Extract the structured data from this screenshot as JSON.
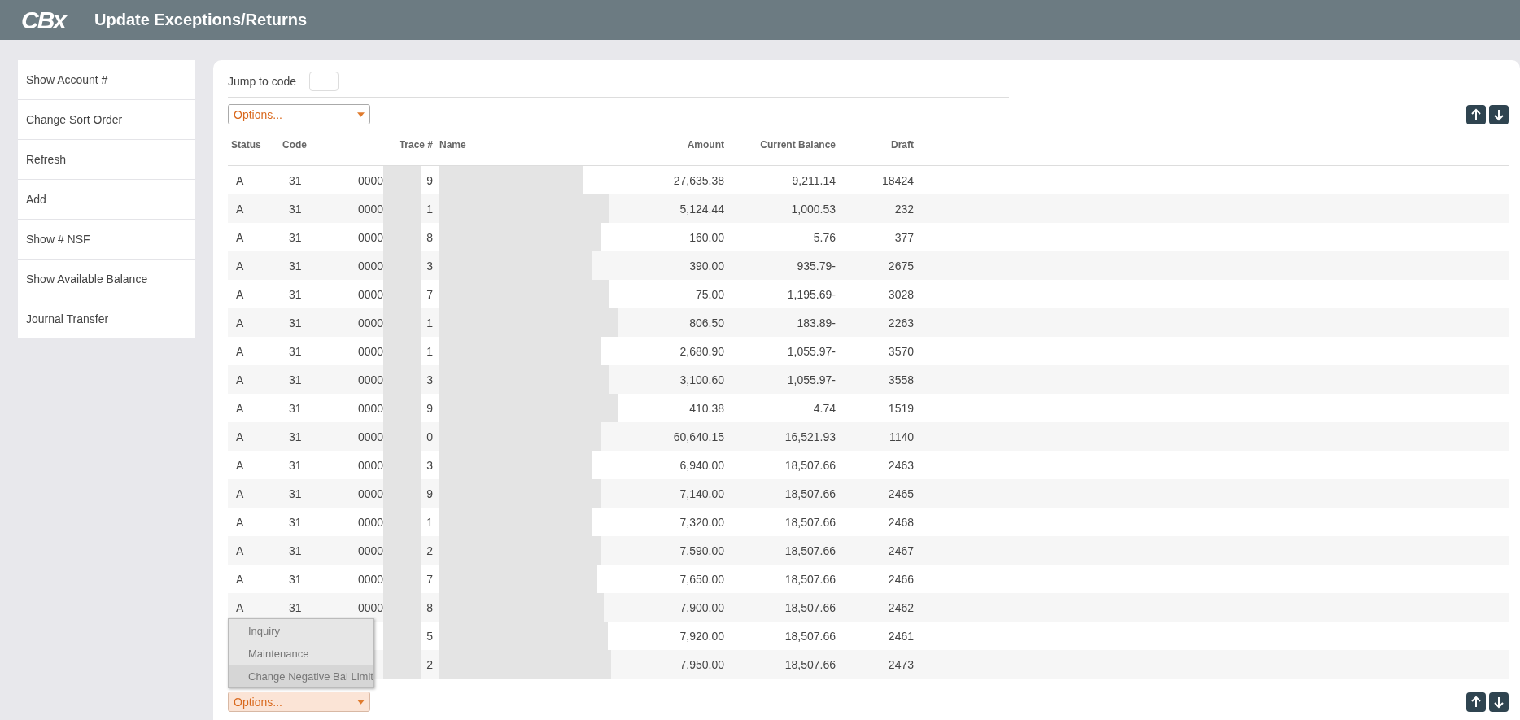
{
  "header": {
    "logo": "CBx",
    "title": "Update Exceptions/Returns"
  },
  "sidebar": {
    "items": [
      {
        "label": "Show Account #"
      },
      {
        "label": "Change Sort Order"
      },
      {
        "label": "Refresh"
      },
      {
        "label": "Add"
      },
      {
        "label": "Show # NSF"
      },
      {
        "label": "Show Available Balance"
      },
      {
        "label": "Journal Transfer"
      }
    ]
  },
  "jump": {
    "label": "Jump to code"
  },
  "options_top": {
    "placeholder": "Options..."
  },
  "table": {
    "columns": [
      "Status",
      "Code",
      "Trace #",
      "Name",
      "Amount",
      "Current Balance",
      "Draft"
    ],
    "rows": [
      {
        "status": "A",
        "code": "31",
        "trace_start": "0000",
        "trace_end": "9",
        "amount": "27,635.38",
        "balance": "9,211.14",
        "draft": "18424"
      },
      {
        "status": "A",
        "code": "31",
        "trace_start": "0000",
        "trace_end": "1",
        "amount": "5,124.44",
        "balance": "1,000.53",
        "draft": "232"
      },
      {
        "status": "A",
        "code": "31",
        "trace_start": "0000",
        "trace_end": "8",
        "amount": "160.00",
        "balance": "5.76",
        "draft": "377"
      },
      {
        "status": "A",
        "code": "31",
        "trace_start": "0000",
        "trace_end": "3",
        "amount": "390.00",
        "balance": "935.79-",
        "draft": "2675"
      },
      {
        "status": "A",
        "code": "31",
        "trace_start": "0000",
        "trace_end": "7",
        "amount": "75.00",
        "balance": "1,195.69-",
        "draft": "3028"
      },
      {
        "status": "A",
        "code": "31",
        "trace_start": "0000",
        "trace_end": "1",
        "amount": "806.50",
        "balance": "183.89-",
        "draft": "2263"
      },
      {
        "status": "A",
        "code": "31",
        "trace_start": "0000",
        "trace_end": "1",
        "amount": "2,680.90",
        "balance": "1,055.97-",
        "draft": "3570"
      },
      {
        "status": "A",
        "code": "31",
        "trace_start": "0000",
        "trace_end": "3",
        "amount": "3,100.60",
        "balance": "1,055.97-",
        "draft": "3558"
      },
      {
        "status": "A",
        "code": "31",
        "trace_start": "0000",
        "trace_end": "9",
        "amount": "410.38",
        "balance": "4.74",
        "draft": "1519"
      },
      {
        "status": "A",
        "code": "31",
        "trace_start": "0000",
        "trace_end": "0",
        "amount": "60,640.15",
        "balance": "16,521.93",
        "draft": "1140"
      },
      {
        "status": "A",
        "code": "31",
        "trace_start": "0000",
        "trace_end": "3",
        "amount": "6,940.00",
        "balance": "18,507.66",
        "draft": "2463"
      },
      {
        "status": "A",
        "code": "31",
        "trace_start": "0000",
        "trace_end": "9",
        "amount": "7,140.00",
        "balance": "18,507.66",
        "draft": "2465"
      },
      {
        "status": "A",
        "code": "31",
        "trace_start": "0000",
        "trace_end": "1",
        "amount": "7,320.00",
        "balance": "18,507.66",
        "draft": "2468"
      },
      {
        "status": "A",
        "code": "31",
        "trace_start": "0000",
        "trace_end": "2",
        "amount": "7,590.00",
        "balance": "18,507.66",
        "draft": "2467"
      },
      {
        "status": "A",
        "code": "31",
        "trace_start": "0000",
        "trace_end": "7",
        "amount": "7,650.00",
        "balance": "18,507.66",
        "draft": "2466"
      },
      {
        "status": "A",
        "code": "31",
        "trace_start": "0000",
        "trace_end": "8",
        "amount": "7,900.00",
        "balance": "18,507.66",
        "draft": "2462"
      },
      {
        "trace_end": "5",
        "amount": "7,920.00",
        "balance": "18,507.66",
        "draft": "2461"
      },
      {
        "trace_end": "2",
        "amount": "7,950.00",
        "balance": "18,507.66",
        "draft": "2473"
      }
    ]
  },
  "menu": {
    "items": [
      {
        "label": "Inquiry",
        "selected": false
      },
      {
        "label": "Maintenance",
        "selected": false
      },
      {
        "label": "Change Negative Bal Limit",
        "selected": true
      }
    ]
  },
  "options_bottom": {
    "placeholder": "Options..."
  }
}
